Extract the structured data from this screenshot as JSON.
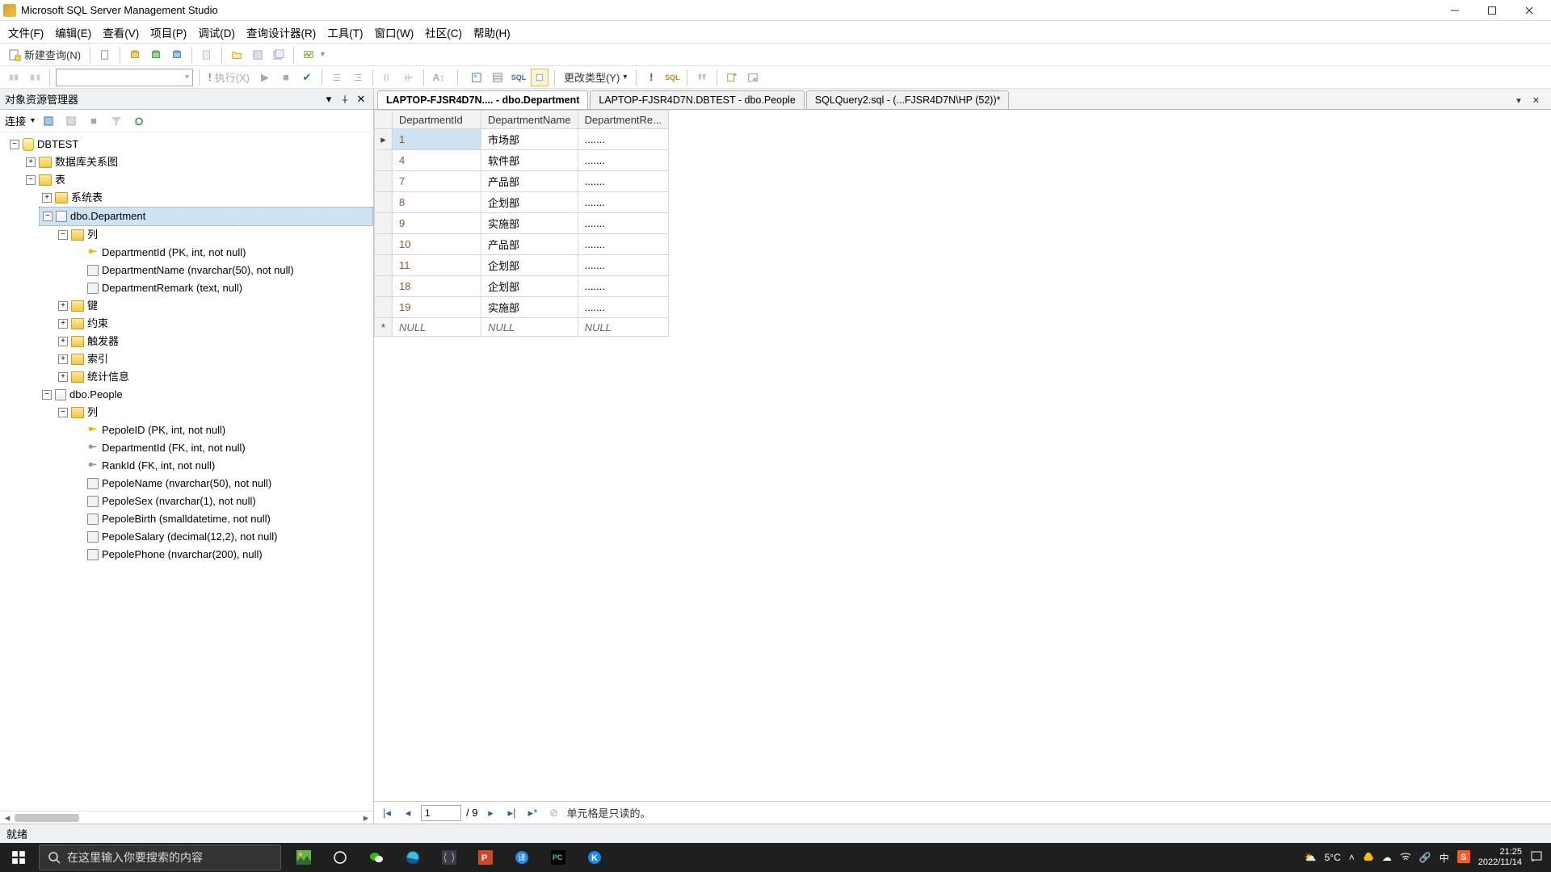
{
  "window": {
    "title": "Microsoft SQL Server Management Studio"
  },
  "menu": {
    "file": "文件(F)",
    "edit": "编辑(E)",
    "view": "查看(V)",
    "project": "项目(P)",
    "debug": "调试(D)",
    "query_designer": "查询设计器(R)",
    "tools": "工具(T)",
    "window_menu": "窗口(W)",
    "community": "社区(C)",
    "help": "帮助(H)"
  },
  "toolbar": {
    "new_query": "新建查询(N)",
    "execute": "执行(X)",
    "change_type": "更改类型(Y)"
  },
  "object_explorer": {
    "title": "对象资源管理器",
    "connect": "连接"
  },
  "tree": {
    "db": "DBTEST",
    "diagrams": "数据库关系图",
    "tables": "表",
    "systables": "系统表",
    "dept_table": "dbo.Department",
    "columns": "列",
    "dept_cols": {
      "c1": "DepartmentId (PK, int, not null)",
      "c2": "DepartmentName (nvarchar(50), not null)",
      "c3": "DepartmentRemark (text, null)"
    },
    "keys": "键",
    "constraints": "约束",
    "triggers": "触发器",
    "indexes": "索引",
    "stats": "统计信息",
    "people_table": "dbo.People",
    "people_cols": {
      "c1": "PepoleID (PK, int, not null)",
      "c2": "DepartmentId (FK, int, not null)",
      "c3": "RankId (FK, int, not null)",
      "c4": "PepoleName (nvarchar(50), not null)",
      "c5": "PepoleSex (nvarchar(1), not null)",
      "c6": "PepoleBirth (smalldatetime, not null)",
      "c7": "PepoleSalary (decimal(12,2), not null)",
      "c8": "PepolePhone (nvarchar(200), null)"
    }
  },
  "tabs": {
    "t1": "LAPTOP-FJSR4D7N.... - dbo.Department",
    "t2": "LAPTOP-FJSR4D7N.DBTEST - dbo.People",
    "t3": "SQLQuery2.sql - (...FJSR4D7N\\HP (52))*"
  },
  "grid": {
    "h1": "DepartmentId",
    "h2": "DepartmentName",
    "h3": "DepartmentRe...",
    "rows": [
      {
        "id": "1",
        "name": "市场部",
        "remark": "......."
      },
      {
        "id": "4",
        "name": "软件部",
        "remark": "......."
      },
      {
        "id": "7",
        "name": "产品部",
        "remark": "......."
      },
      {
        "id": "8",
        "name": "企划部",
        "remark": "......."
      },
      {
        "id": "9",
        "name": "实施部",
        "remark": "......."
      },
      {
        "id": "10",
        "name": "产品部",
        "remark": "......."
      },
      {
        "id": "11",
        "name": "企划部",
        "remark": "......."
      },
      {
        "id": "18",
        "name": "企划部",
        "remark": "......."
      },
      {
        "id": "19",
        "name": "实施部",
        "remark": "......."
      }
    ],
    "null": "NULL"
  },
  "nav": {
    "pos": "1",
    "total": "/ 9",
    "readonly": "单元格是只读的。"
  },
  "status": {
    "text": "就绪"
  },
  "taskbar": {
    "search_placeholder": "在这里输入你要搜索的内容",
    "temp": "5°C",
    "ime": "中",
    "time": "21:25",
    "date": "2022/11/14"
  }
}
